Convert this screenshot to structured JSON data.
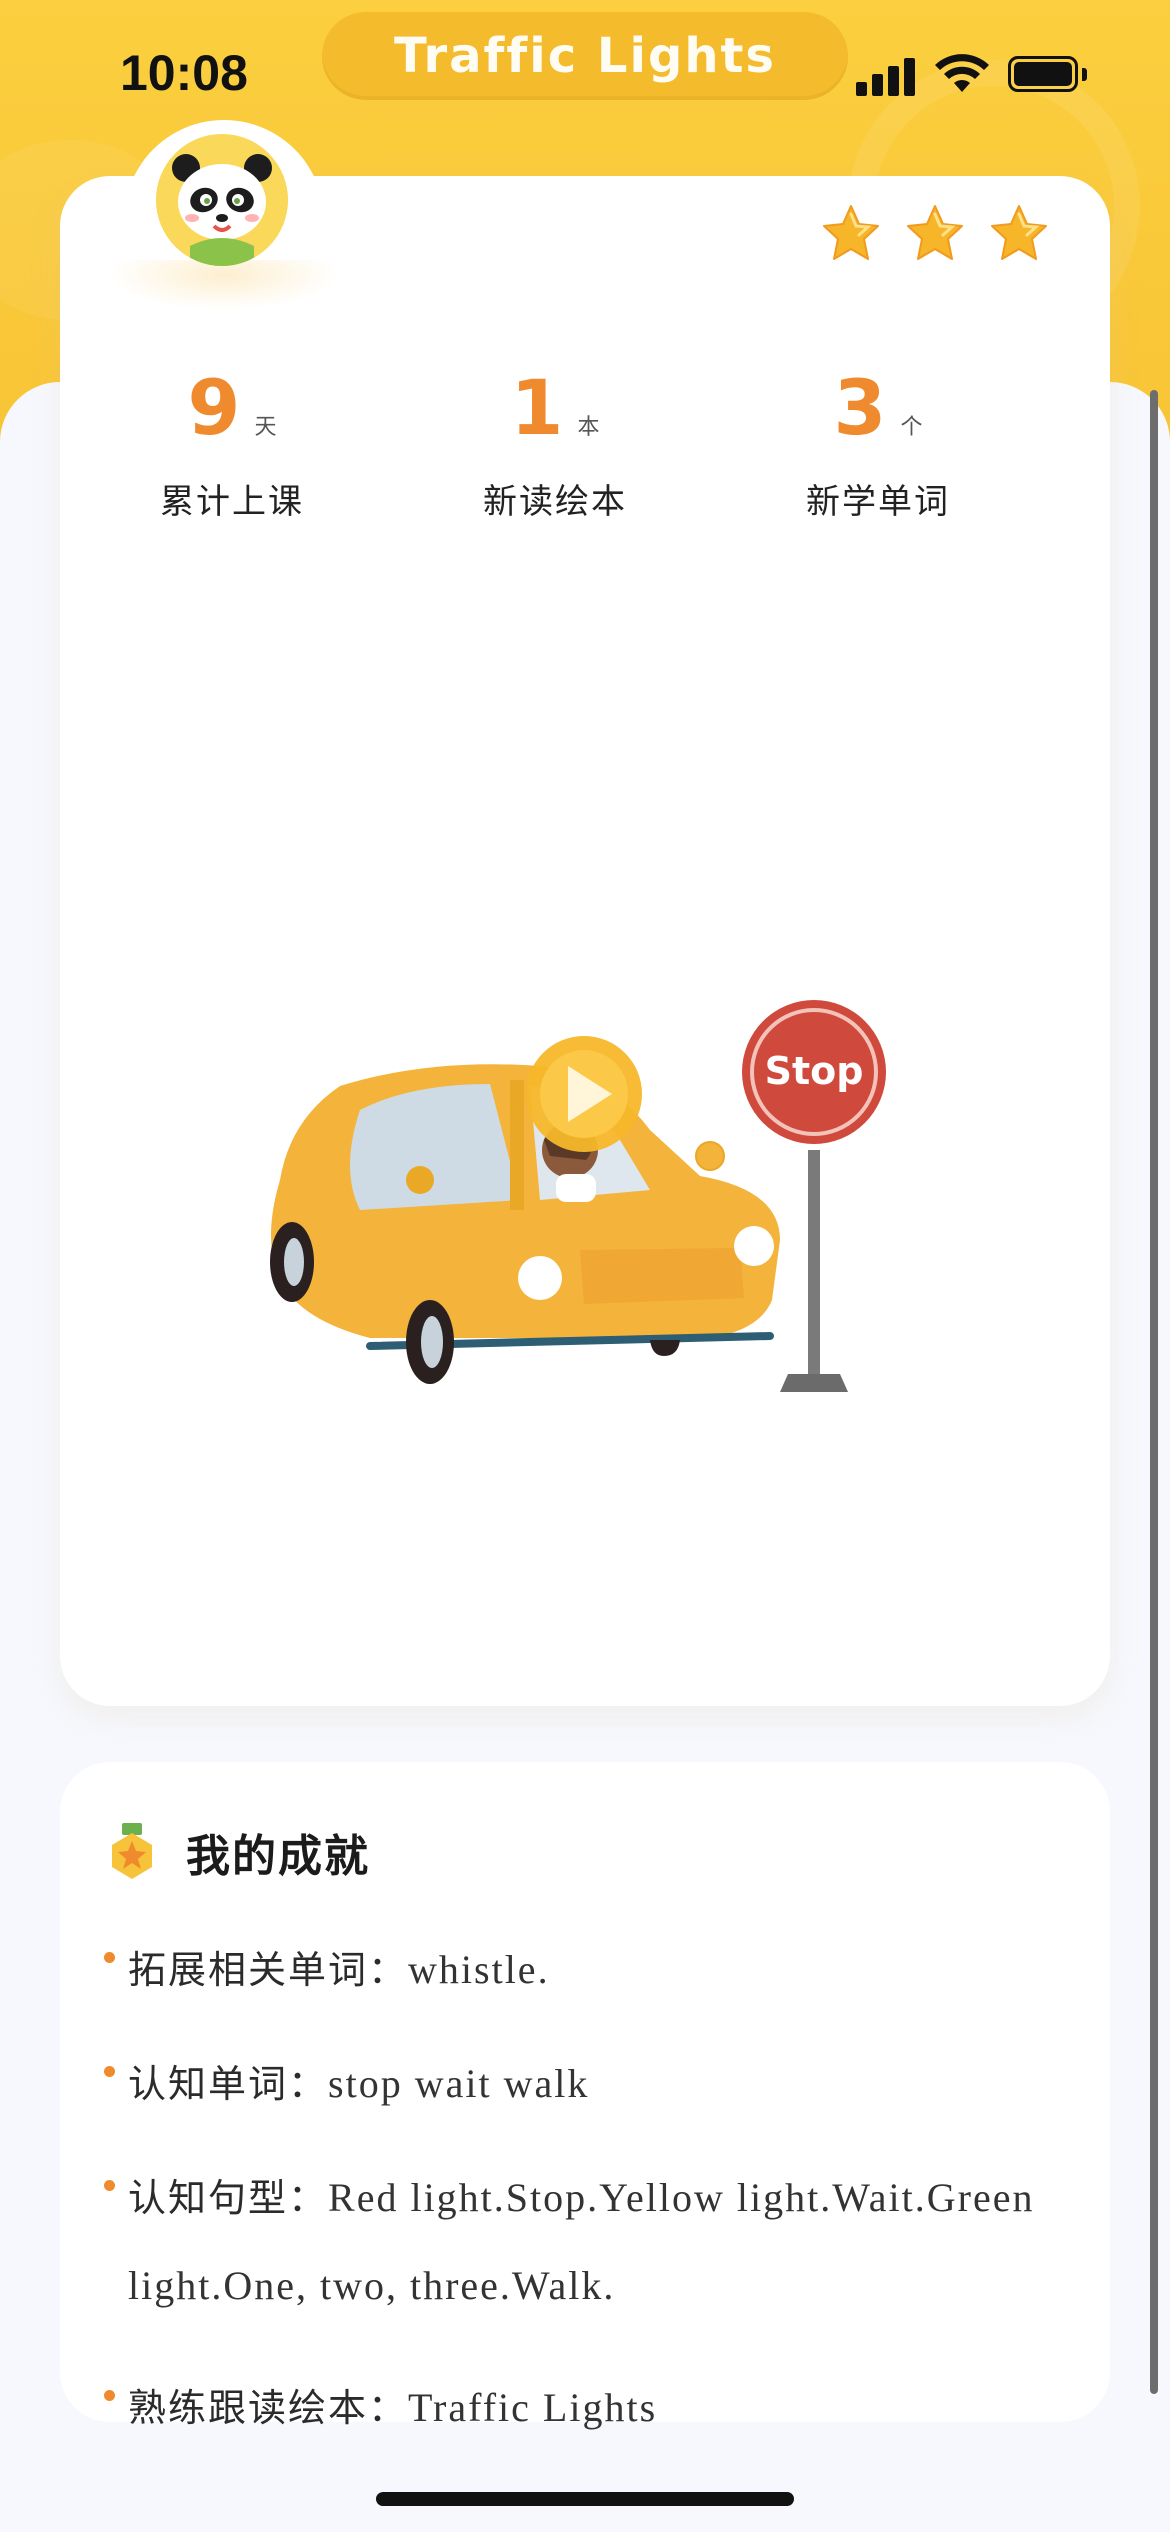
{
  "status": {
    "time": "10:08"
  },
  "header": {
    "title": "Traffic Lights"
  },
  "stars": {
    "count": 3,
    "color": "#f7b529"
  },
  "stats": [
    {
      "value": "9",
      "unit": "天",
      "label": "累计上课"
    },
    {
      "value": "1",
      "unit": "本",
      "label": "新读绘本"
    },
    {
      "value": "3",
      "unit": "个",
      "label": "新学单词"
    }
  ],
  "illustration": {
    "sign_text": "Stop",
    "play": "play-icon"
  },
  "achievements": {
    "title": "我的成就",
    "items": [
      {
        "key": "拓展相关单词：",
        "value": "whistle."
      },
      {
        "key": "认知单词：",
        "value": "stop wait walk"
      },
      {
        "key": "认知句型：",
        "value": "Red light.Stop.Yellow light.Wait.Green light.One, two, three.Walk."
      },
      {
        "key": "熟练跟读绘本：",
        "value": "Traffic Lights"
      }
    ]
  },
  "colors": {
    "accent": "#f08a2e",
    "header": "#fbcf3f",
    "title_pill": "#f4bb2c"
  }
}
